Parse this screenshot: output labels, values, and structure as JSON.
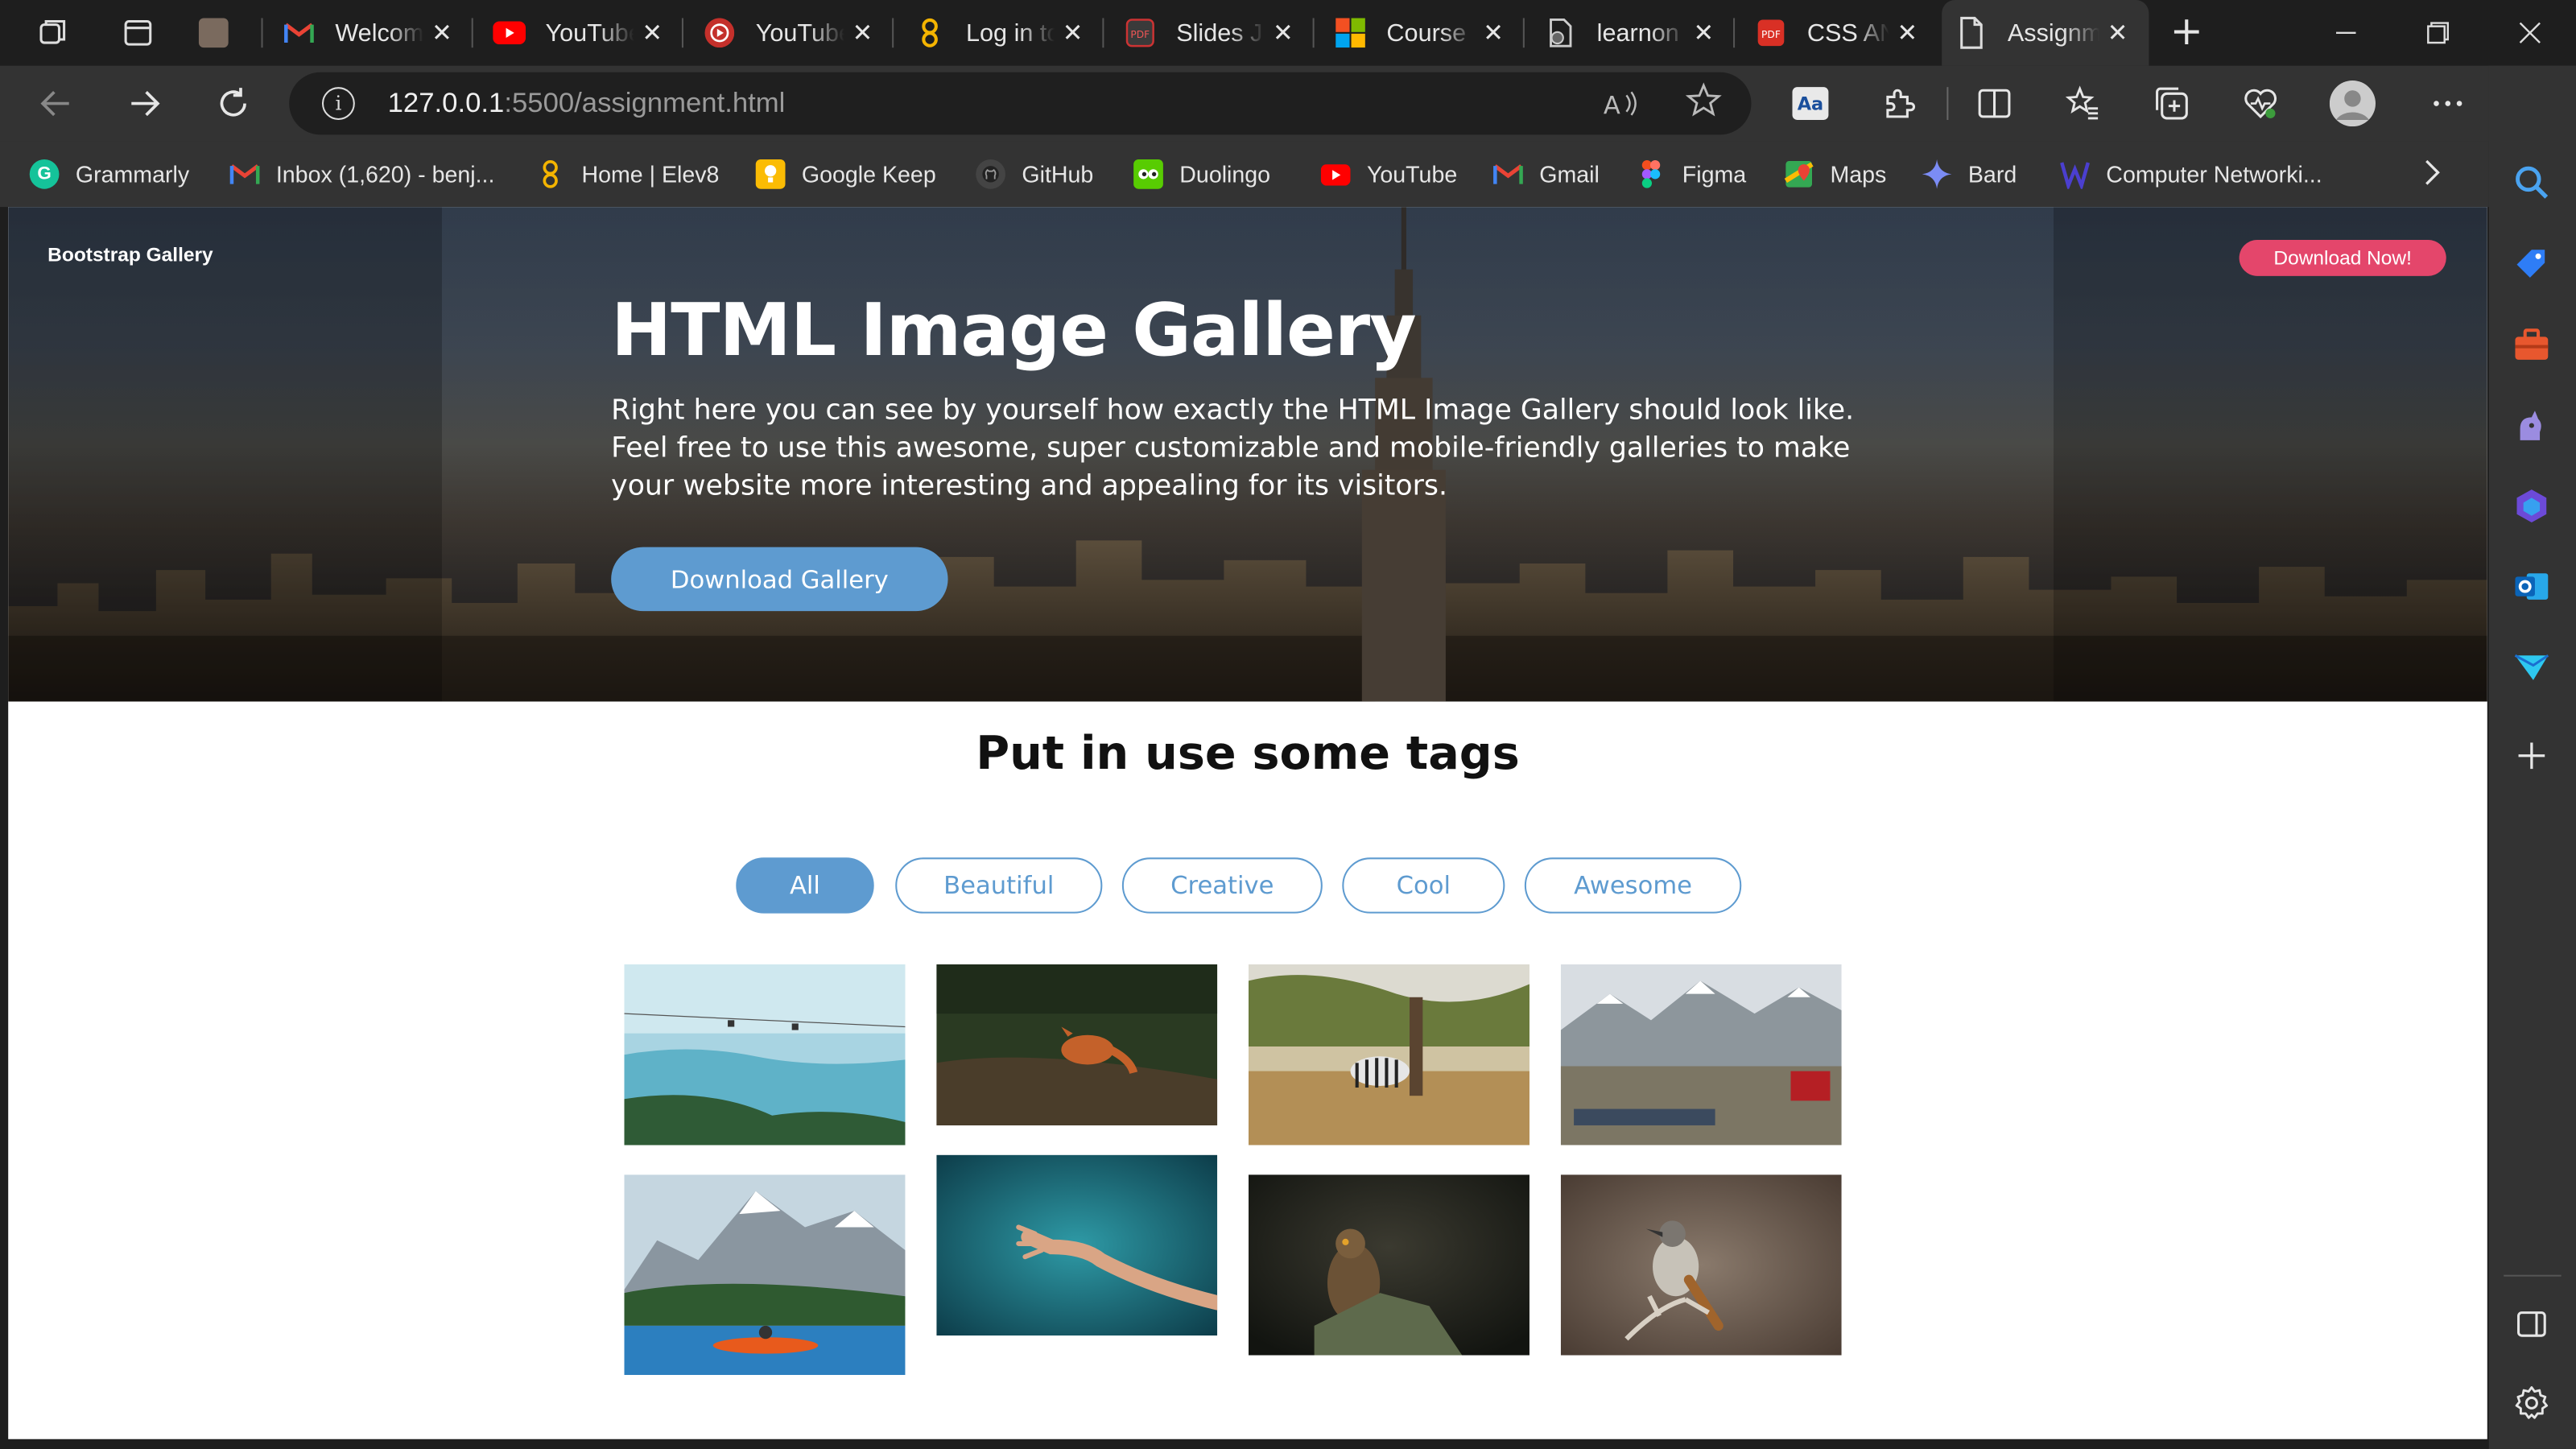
{
  "browser": {
    "tabs": [
      {
        "label": "",
        "icon": "profile-photo-icon"
      },
      {
        "label": "Welcome",
        "icon": "gmail-icon"
      },
      {
        "label": "YouTube",
        "icon": "youtube-icon"
      },
      {
        "label": "YouTube",
        "icon": "youtube-music-icon"
      },
      {
        "label": "Log in to",
        "icon": "elev8-icon"
      },
      {
        "label": "Slides J",
        "icon": "pdf-icon"
      },
      {
        "label": "Course",
        "icon": "microsoft-icon"
      },
      {
        "label": "learnon",
        "icon": "document-icon"
      },
      {
        "label": "CSS AN",
        "icon": "pdf-icon"
      },
      {
        "label": "Assignm",
        "icon": "page-icon"
      }
    ],
    "address": {
      "host": "127.0.0.1",
      "rest": ":5500/assignment.html"
    },
    "read_aloud": "Aͅ",
    "bookmarks": [
      {
        "label": "Grammarly",
        "color": "#15c39a"
      },
      {
        "label": "Inbox (1,620) - benj...",
        "color": "#ea4335"
      },
      {
        "label": "Home | Elev8",
        "color": "#f4b400"
      },
      {
        "label": "Google Keep",
        "color": "#fbbc04"
      },
      {
        "label": "GitHub",
        "color": "#444444"
      },
      {
        "label": "Duolingo",
        "color": "#58cc02"
      },
      {
        "label": "YouTube",
        "color": "#ff0000"
      },
      {
        "label": "Gmail",
        "color": "#ea4335"
      },
      {
        "label": "Figma",
        "color": "#a259ff"
      },
      {
        "label": "Maps",
        "color": "#34a853"
      },
      {
        "label": "Bard",
        "color": "#4285f4"
      },
      {
        "label": "Computer Networki...",
        "color": "#4b3fcf"
      }
    ]
  },
  "page": {
    "brand": "Bootstrap Gallery",
    "download_now": "Download Now!",
    "hero_title": "HTML Image Gallery",
    "hero_text": "Right here you can see by yourself how exactly the HTML Image Gallery should look like. Feel free to use this awesome, super customizable and mobile-friendly galleries to make your website more interesting and appealing for its visitors.",
    "download_gallery": "Download Gallery",
    "tags_heading": "Put in use some tags",
    "tags": [
      "All",
      "Beautiful",
      "Creative",
      "Cool",
      "Awesome"
    ],
    "accent": "#5e9bd0",
    "images": [
      {
        "name": "lake-cable-car-photo"
      },
      {
        "name": "fox-forest-photo"
      },
      {
        "name": "zebra-savanna-photo"
      },
      {
        "name": "mountain-village-photo"
      },
      {
        "name": "kayak-mountain-lake-photo"
      },
      {
        "name": "hand-in-water-photo"
      },
      {
        "name": "owl-on-glove-photo"
      },
      {
        "name": "bird-on-branch-photo"
      }
    ]
  }
}
